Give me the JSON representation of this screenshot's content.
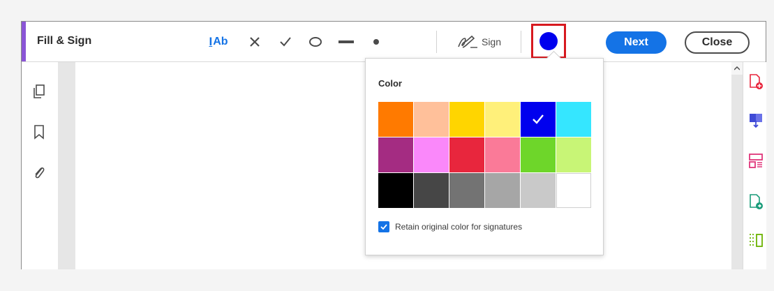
{
  "header": {
    "title": "Fill & Sign",
    "add_text_label": "Ab",
    "sign_label": "Sign",
    "next_label": "Next",
    "close_label": "Close",
    "selected_color": "#0000ee"
  },
  "toolbar_tools": [
    {
      "name": "add-text-tool",
      "icon": "text-cursor-icon"
    },
    {
      "name": "cross-mark-tool",
      "icon": "cross-icon"
    },
    {
      "name": "checkmark-tool",
      "icon": "check-icon"
    },
    {
      "name": "circle-tool",
      "icon": "circle-icon"
    },
    {
      "name": "line-tool",
      "icon": "line-icon"
    },
    {
      "name": "dot-tool",
      "icon": "dot-icon"
    }
  ],
  "left_sidebar": [
    "pages-icon",
    "bookmark-icon",
    "attachment-icon"
  ],
  "right_sidebar": [
    "create-pdf-icon",
    "export-pdf-icon",
    "organize-pages-icon",
    "edit-pdf-icon",
    "compress-icon"
  ],
  "color_popup": {
    "title": "Color",
    "selected_index": 4,
    "swatches": [
      "#ff7a00",
      "#ffc09a",
      "#ffd500",
      "#fff07a",
      "#0000ee",
      "#35e6ff",
      "#a42c82",
      "#fa88fa",
      "#e8263d",
      "#fa7a98",
      "#6ed62a",
      "#c8f576",
      "#000000",
      "#464646",
      "#737373",
      "#a6a6a6",
      "#c9c9c9",
      "#ffffff"
    ],
    "retain_label": "Retain original color for signatures",
    "retain_checked": true
  }
}
